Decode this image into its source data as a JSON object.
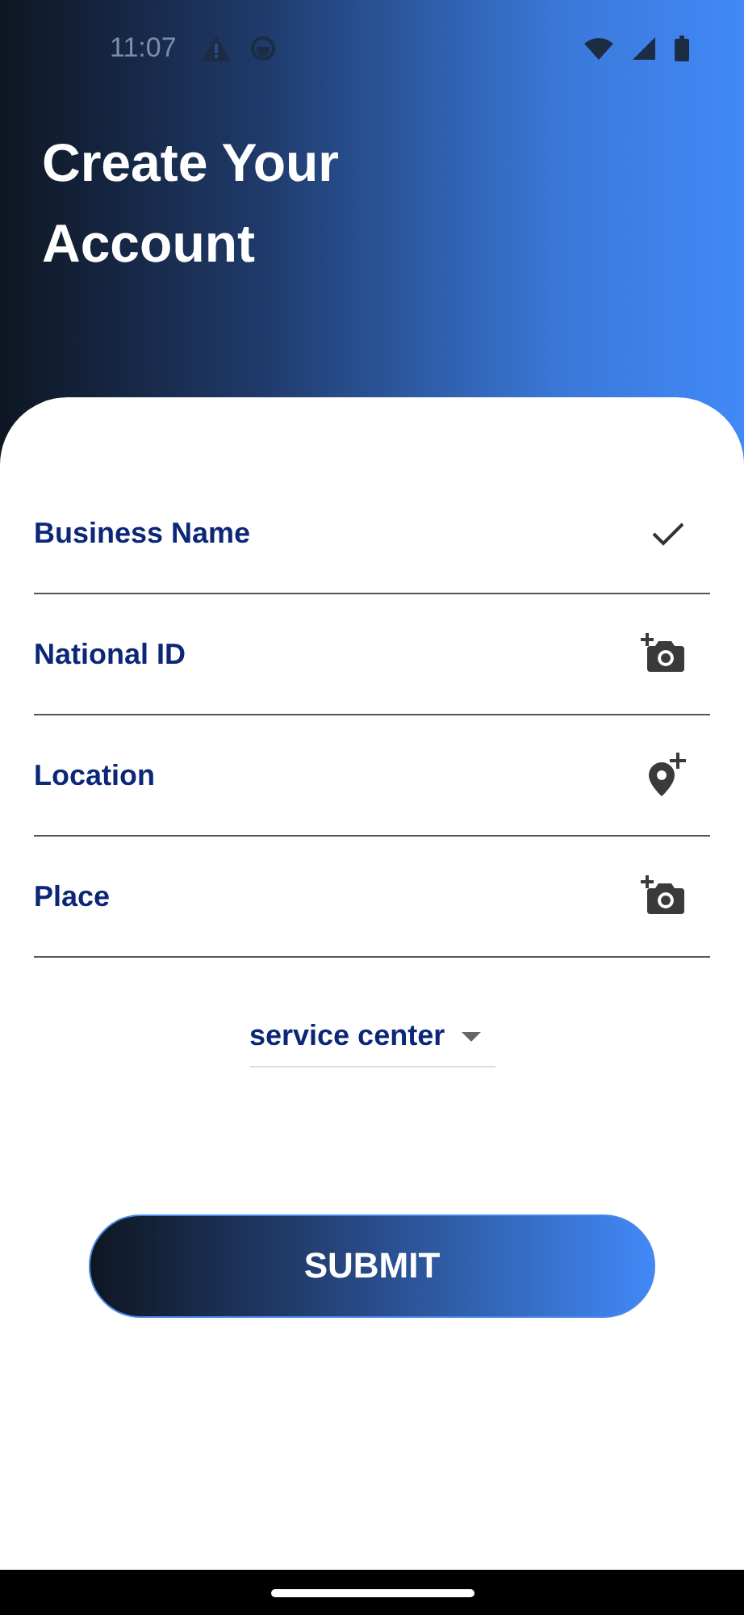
{
  "status_bar": {
    "time": "11:07"
  },
  "header": {
    "title": "Create Your Account"
  },
  "fields": [
    {
      "label": "Business Name",
      "kind": "check"
    },
    {
      "label": "National ID",
      "kind": "photo"
    },
    {
      "label": "Location",
      "kind": "location"
    },
    {
      "label": "Place",
      "kind": "photo"
    }
  ],
  "dropdown": {
    "value": "service center"
  },
  "submit_button": {
    "label": "SUBMIT"
  }
}
